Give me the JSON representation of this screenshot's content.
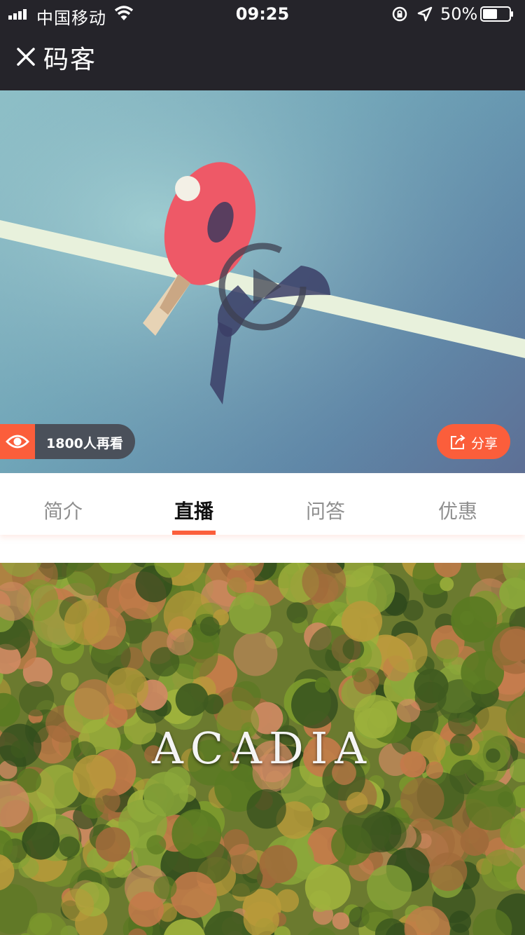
{
  "status_bar": {
    "carrier": "中国移动",
    "time": "09:25",
    "battery": "50%"
  },
  "nav": {
    "title": "码客"
  },
  "video": {
    "viewers": "1800人再看",
    "share_label": "分享"
  },
  "tabs": [
    {
      "label": "简介"
    },
    {
      "label": "直播"
    },
    {
      "label": "问答"
    },
    {
      "label": "优惠"
    }
  ],
  "feed": {
    "cover_text": "ACADIA"
  },
  "colors": {
    "accent": "#fb5e3b",
    "nav_bg": "#25242a"
  }
}
